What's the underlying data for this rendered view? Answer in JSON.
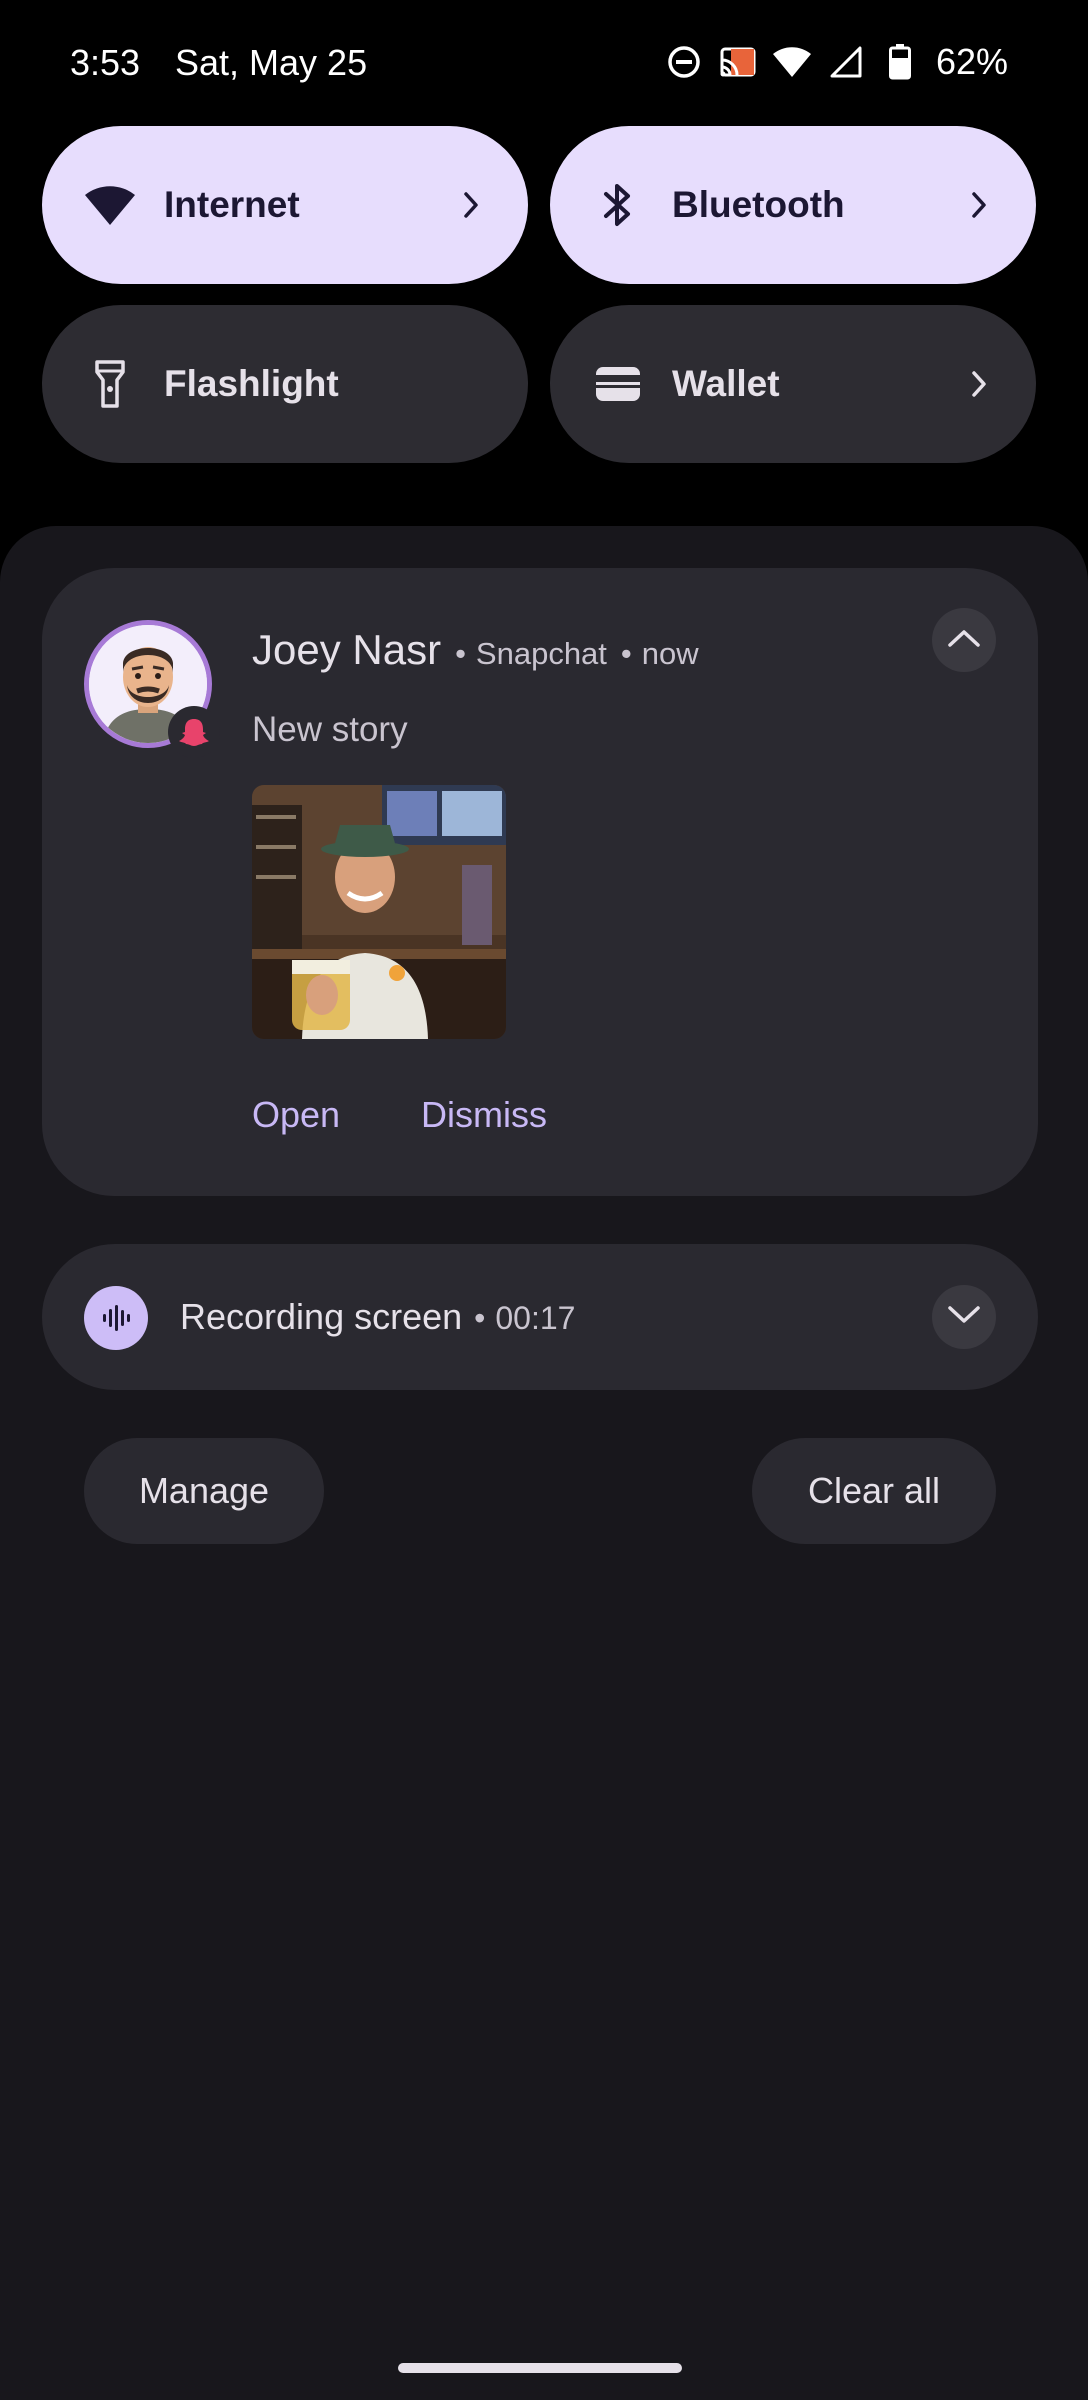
{
  "status_bar": {
    "time": "3:53",
    "date": "Sat, May 25",
    "battery_text": "62%",
    "icons": [
      "do-not-disturb-icon",
      "screen-cast-icon",
      "wifi-icon",
      "cellular-signal-icon",
      "battery-icon"
    ]
  },
  "quick_settings": {
    "tiles": [
      {
        "label": "Internet",
        "icon": "wifi-icon",
        "active": true,
        "has_chevron": true
      },
      {
        "label": "Bluetooth",
        "icon": "bluetooth-icon",
        "active": true,
        "has_chevron": true
      },
      {
        "label": "Flashlight",
        "icon": "flashlight-icon",
        "active": false,
        "has_chevron": false
      },
      {
        "label": "Wallet",
        "icon": "wallet-icon",
        "active": false,
        "has_chevron": true
      }
    ]
  },
  "notification": {
    "sender": "Joey Nasr",
    "app": "Snapchat",
    "time": "now",
    "separator": "•",
    "text": "New story",
    "actions": {
      "open": "Open",
      "dismiss": "Dismiss"
    }
  },
  "recording": {
    "title": "Recording screen",
    "separator": "•",
    "elapsed": "00:17"
  },
  "footer": {
    "manage": "Manage",
    "clear_all": "Clear all"
  },
  "colors": {
    "tile_active": "#e7ddfd",
    "tile_inactive": "#2d2c32",
    "accent_text": "#c8b8f5",
    "snapchat_badge": "#e8436b",
    "card_bg": "#2a2930",
    "shade_bg": "#18171c"
  }
}
